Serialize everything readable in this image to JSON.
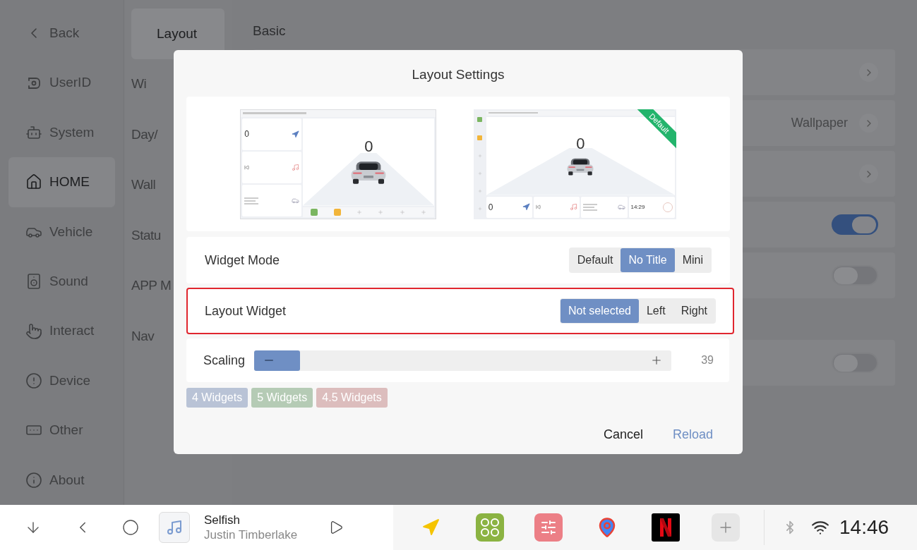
{
  "sidebar": {
    "items": [
      {
        "label": "Back",
        "selected": false
      },
      {
        "label": "UserID",
        "selected": false
      },
      {
        "label": "System",
        "selected": false
      },
      {
        "label": "HOME",
        "selected": true
      },
      {
        "label": "Vehicle",
        "selected": false
      },
      {
        "label": "Sound",
        "selected": false
      },
      {
        "label": "Interact",
        "selected": false
      },
      {
        "label": "Device",
        "selected": false
      },
      {
        "label": "Other",
        "selected": false
      },
      {
        "label": "About",
        "selected": false
      }
    ]
  },
  "subnav": {
    "items": [
      {
        "label": "Layout",
        "selected": true
      },
      {
        "label": "Wi",
        "selected": false
      },
      {
        "label": "Day/",
        "selected": false
      },
      {
        "label": "Wall",
        "selected": false
      },
      {
        "label": "Statu",
        "selected": false
      },
      {
        "label": "APP M",
        "selected": false
      },
      {
        "label": "Nav",
        "selected": false
      }
    ]
  },
  "content": {
    "heading": "Basic",
    "groups": [
      [
        {
          "kind": "link"
        },
        {
          "kind": "link",
          "value": "Wallpaper"
        },
        {
          "kind": "link"
        },
        {
          "kind": "toggle",
          "on": true
        },
        {
          "kind": "toggle",
          "on": false
        }
      ],
      [
        {
          "kind": "toggle",
          "on": false
        }
      ]
    ]
  },
  "dialog": {
    "title": "Layout Settings",
    "previews": [
      {
        "kind": "side",
        "speed": "0",
        "nav_speed": "0"
      },
      {
        "kind": "bottom",
        "speed": "0",
        "nav_speed": "0",
        "clock": "14:29",
        "badge": "Default"
      }
    ],
    "widget_mode": {
      "label": "Widget Mode",
      "highlighted": false,
      "options": [
        {
          "label": "Default",
          "selected": false
        },
        {
          "label": "No Title",
          "selected": true
        },
        {
          "label": "Mini",
          "selected": false
        }
      ]
    },
    "layout_widget": {
      "label": "Layout Widget",
      "highlighted": true,
      "options": [
        {
          "label": "Not selected",
          "selected": true
        },
        {
          "label": "Left",
          "selected": false
        },
        {
          "label": "Right",
          "selected": false
        }
      ]
    },
    "scaling": {
      "label": "Scaling",
      "level": 0.11,
      "reading": "39"
    },
    "presets": [
      {
        "label": "4 Widgets",
        "color": "#b9c3d6"
      },
      {
        "label": "5 Widgets",
        "color": "#b5cbb5"
      },
      {
        "label": "4.5 Widgets",
        "color": "#dcbdbd"
      }
    ],
    "buttons": [
      {
        "label": "Cancel",
        "kind": "secondary"
      },
      {
        "label": "Reload",
        "kind": "primary"
      }
    ]
  },
  "taskbar": {
    "media": {
      "title": "Selfish",
      "artist": "Justin Timberlake"
    },
    "clock": "14:46"
  }
}
